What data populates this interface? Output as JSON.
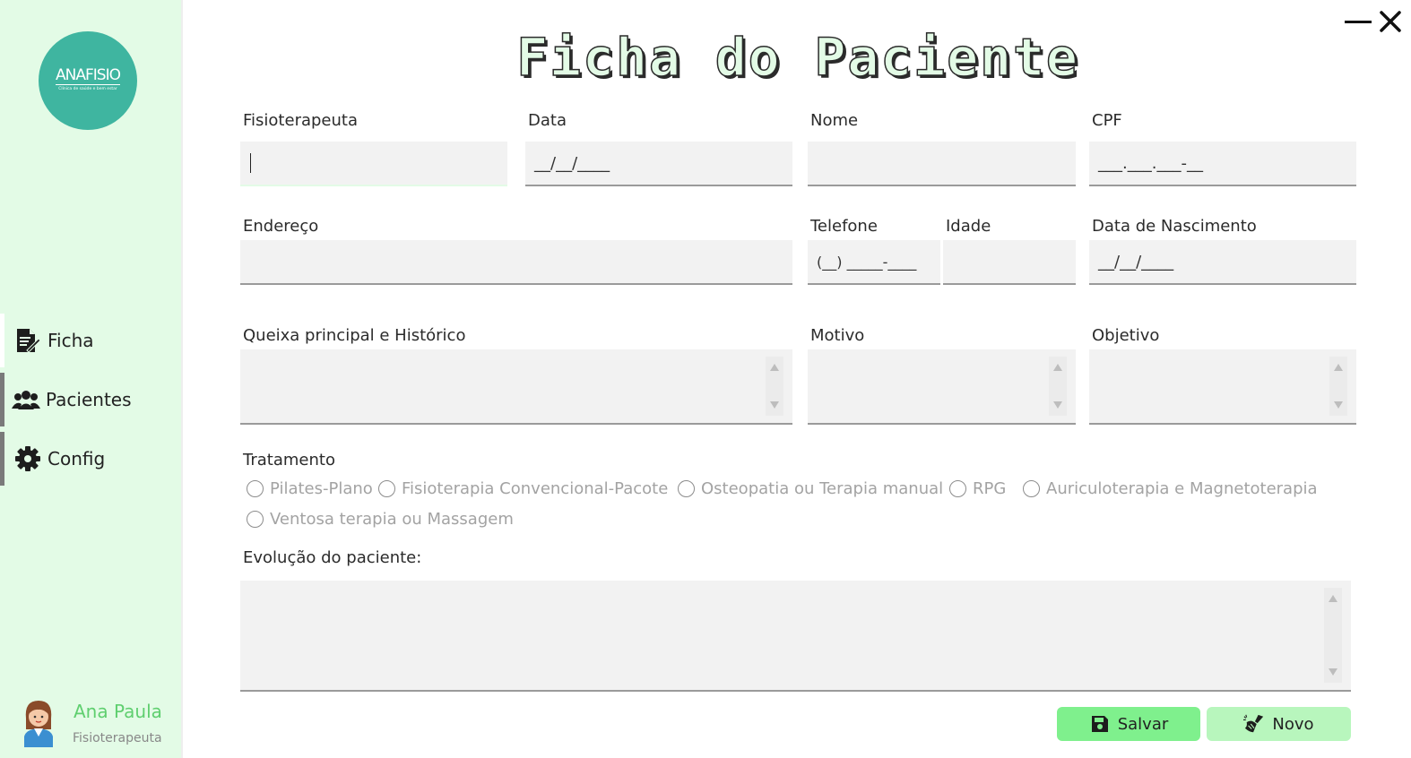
{
  "app": {
    "logo_name": "ANAFISIO",
    "logo_tagline": "Clínica de saúde e bem estar"
  },
  "sidebar": {
    "items": [
      {
        "label": "Ficha",
        "icon": "document-edit-icon"
      },
      {
        "label": "Pacientes",
        "icon": "users-icon"
      },
      {
        "label": "Config",
        "icon": "gear-icon"
      }
    ],
    "user": {
      "name": "Ana Paula",
      "role": "Fisioterapeuta"
    }
  },
  "title": "Ficha do Paciente",
  "form": {
    "fisioterapeuta": {
      "label": "Fisioterapeuta",
      "value": ""
    },
    "data": {
      "label": "Data",
      "value": "__/__/____"
    },
    "nome": {
      "label": "Nome",
      "value": ""
    },
    "cpf": {
      "label": "CPF",
      "value": "___.___.___-__"
    },
    "endereco": {
      "label": "Endereço",
      "value": ""
    },
    "telefone": {
      "label": "Telefone",
      "value": "(__) _____-____"
    },
    "idade": {
      "label": "Idade",
      "value": ""
    },
    "nascimento": {
      "label": "Data de Nascimento",
      "value": "__/__/____"
    },
    "queixa": {
      "label": "Queixa principal e Histórico"
    },
    "motivo": {
      "label": "Motivo"
    },
    "objetivo": {
      "label": "Objetivo"
    },
    "tratamento": {
      "label": "Tratamento",
      "options": [
        "Pilates-Plano",
        "Fisioterapia Convencional-Pacote",
        "Osteopatia ou Terapia manual",
        "RPG",
        "Auriculoterapia e Magnetoterapia",
        "Ventosa terapia ou Massagem"
      ]
    },
    "evolucao": {
      "label": "Evolução do paciente:"
    }
  },
  "buttons": {
    "salvar": "Salvar",
    "novo": "Novo"
  },
  "colors": {
    "sidebar_bg": "#e3fbe6",
    "logo_bg": "#3fb5a0",
    "salvar_bg": "#7ff08d",
    "novo_bg": "#b8f6bd",
    "user_name": "#5fcf6f"
  }
}
